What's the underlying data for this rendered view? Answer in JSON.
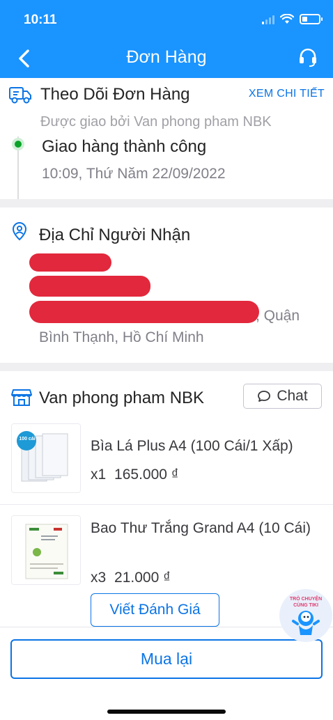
{
  "status_bar": {
    "time": "10:11",
    "battery_level": 0.3
  },
  "header": {
    "title": "Đơn Hàng",
    "back_icon": "chevron-left-icon",
    "support_icon": "headset-icon"
  },
  "tracking": {
    "title": "Theo Dõi Đơn Hàng",
    "detail_link": "XEM CHI TIẾT",
    "shipped_by": "Được giao bởi Van phong pham NBK",
    "status": "Giao hàng thành công",
    "time": "10:09, Thứ Năm 22/09/2022",
    "status_color": "#0ba32a"
  },
  "address": {
    "title": "Địa Chỉ Người Nhận",
    "line_tail": ", Quận",
    "line_last": "Bình Thạnh, Hồ Chí Minh"
  },
  "shop": {
    "name": "Van phong pham NBK",
    "chat_label": "Chat",
    "items": [
      {
        "name": "Bìa Lá Plus A4 (100 Cái/1 Xấp)",
        "quantity": "x1",
        "price": "165.000 ₫",
        "thumb_badge": "100 cái"
      },
      {
        "name": "Bao Thư Trắng Grand A4 (10 Cái)",
        "quantity": "x3",
        "price": "21.000 ₫"
      }
    ],
    "review_label": "Viết Đánh Giá"
  },
  "footer": {
    "rebuy_label": "Mua lại"
  },
  "floating_chat": {
    "label_line1": "TRÒ CHUYỆN",
    "label_line2": "CÙNG TIKI"
  },
  "colors": {
    "brand": "#1a94ff",
    "link": "#0b74e5",
    "redaction": "#e2283c"
  }
}
